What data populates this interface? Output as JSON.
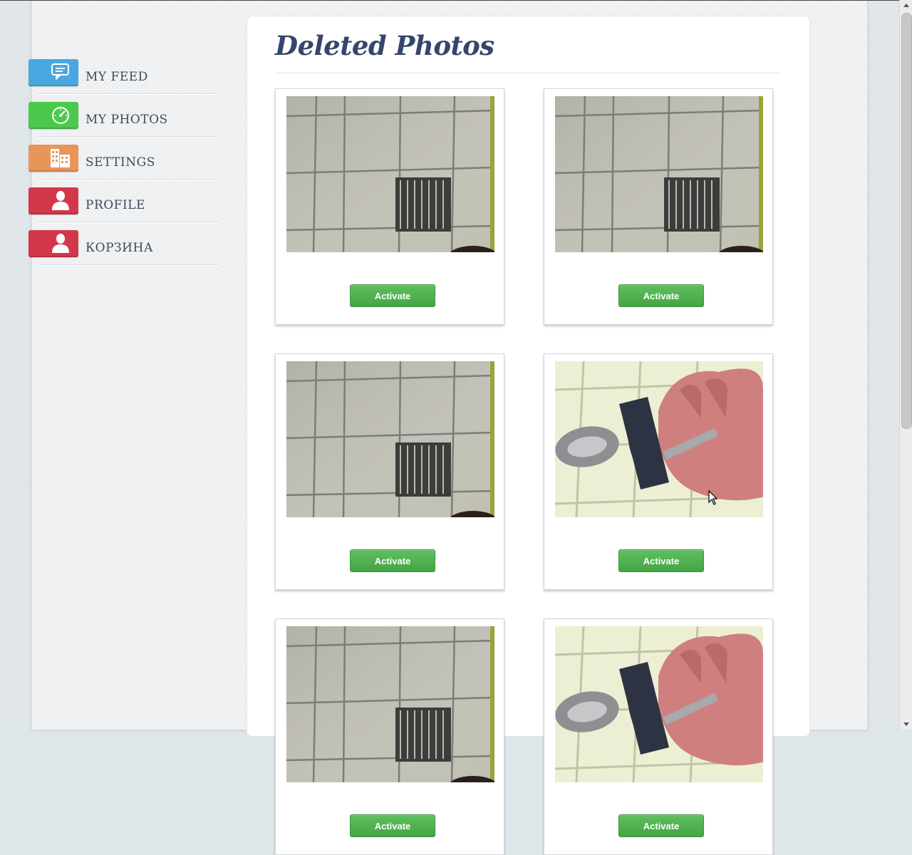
{
  "sidebar": {
    "items": [
      {
        "label": "MY FEED",
        "icon": "chat-icon",
        "color": "#4aa8e0"
      },
      {
        "label": "MY PHOTOS",
        "icon": "speedometer-icon",
        "color": "#4cc94c"
      },
      {
        "label": "SETTINGS",
        "icon": "building-icon",
        "color": "#e8955a"
      },
      {
        "label": "PROFILE",
        "icon": "user-icon",
        "color": "#d2384a"
      },
      {
        "label": "КОРЗИНА",
        "icon": "user-icon",
        "color": "#d2384a"
      }
    ]
  },
  "main": {
    "title": "Deleted Photos",
    "photos": [
      {
        "subject": "ceiling tiles with vent",
        "button_label": "Activate"
      },
      {
        "subject": "ceiling tiles with vent",
        "button_label": "Activate"
      },
      {
        "subject": "ceiling tiles with vent",
        "button_label": "Activate"
      },
      {
        "subject": "hand holding keys",
        "button_label": "Activate"
      },
      {
        "subject": "ceiling tiles with vent",
        "button_label": "Activate"
      },
      {
        "subject": "hand holding keys",
        "button_label": "Activate"
      }
    ]
  },
  "colors": {
    "accent_green": "#4cae4c",
    "title_color": "#34466b",
    "nav_text": "#3e4a5e"
  }
}
